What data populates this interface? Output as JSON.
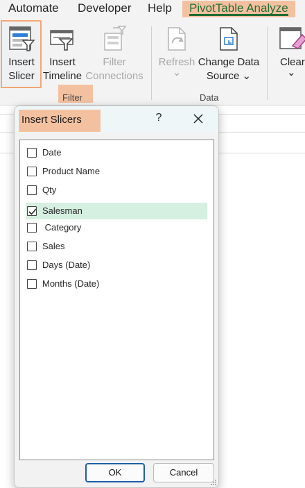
{
  "ribbon_tabs": [
    "Automate",
    "Developer",
    "Help",
    "PivotTable Analyze"
  ],
  "ribbon": {
    "insert_slicer": [
      "Insert",
      "Slicer"
    ],
    "insert_timeline": [
      "Insert",
      "Timeline"
    ],
    "filter_connections": [
      "Filter",
      "Connections"
    ],
    "filter_group": "Filter",
    "refresh": "Refresh",
    "refresh_arrow": "⌄",
    "change_data_source": [
      "Change Data",
      "Source ⌄"
    ],
    "data_group": "Data",
    "clear": "Clear",
    "clear_arrow": "⌄"
  },
  "dialog": {
    "title": "Insert Slicers",
    "help": "?",
    "fields": [
      {
        "label": "Date",
        "checked": false
      },
      {
        "label": "Product Name",
        "checked": false
      },
      {
        "label": "Qty",
        "checked": false
      },
      {
        "label": "Salesman",
        "checked": true
      },
      {
        "label": " Category",
        "checked": false
      },
      {
        "label": "Sales",
        "checked": false
      },
      {
        "label": "Days (Date)",
        "checked": false
      },
      {
        "label": "Months (Date)",
        "checked": false
      }
    ],
    "ok_label": "OK",
    "cancel_label": "Cancel"
  },
  "colors": {
    "highlight": "#f4c1a0",
    "active_tab_text": "#1e6e35",
    "selected_row": "#d5efe1",
    "ok_border": "#1d5ea8"
  }
}
